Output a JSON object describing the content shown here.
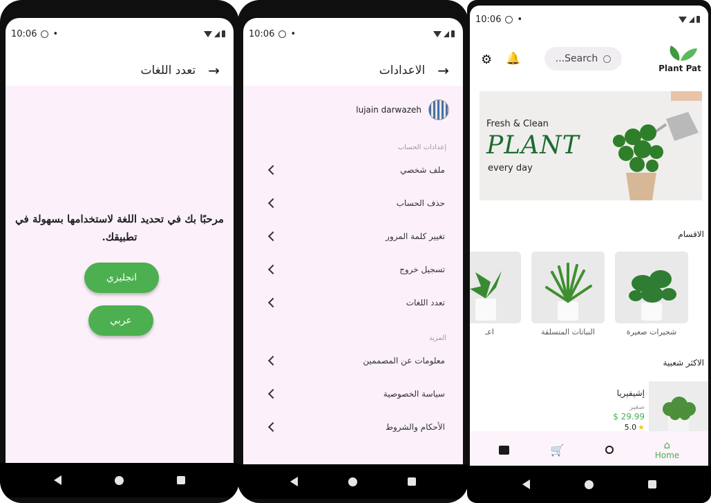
{
  "status": {
    "time": "10:06",
    "dot": "•"
  },
  "screen1": {
    "title": "تعدد اللغات",
    "welcome": "مرحبًا بك في تحديد اللغة لاستخدامها بسهولة في تطبيقك.",
    "btn_english": "انجليزي",
    "btn_arabic": "عربي"
  },
  "screen2": {
    "title": "الاعدادات",
    "user_name": "lujain darwazeh",
    "section_account": "إعدادات الحساب",
    "account_items": [
      "ملف شخصي",
      "حذف الحساب",
      "تغيير كلمة المرور",
      "تسجيل خروج",
      "تعدد اللغات"
    ],
    "section_more": "المزيد",
    "more_items": [
      "معلومات عن المصممين",
      "سياسة الخصوصية",
      "الأحكام والشروط"
    ]
  },
  "screen3": {
    "search_placeholder": "...Search",
    "logo_text": "Plant Pat",
    "banner": {
      "line1": "Fresh & Clean",
      "line2": "PLANT",
      "line3": "every day"
    },
    "categories_title": "الاقسام",
    "categories": [
      "شجيرات صغيرة",
      "النباتات المتسلقة",
      "اعـ"
    ],
    "popular_title": "الاكثر شعبية",
    "product": {
      "name": "إشيفيريا",
      "size": "صغير",
      "price": "$ 29.99",
      "rating": "5.0"
    },
    "nav_home": "Home"
  },
  "colors": {
    "accent": "#4caf50",
    "lavender": "#fcf1fa",
    "star": "#f5c518"
  }
}
